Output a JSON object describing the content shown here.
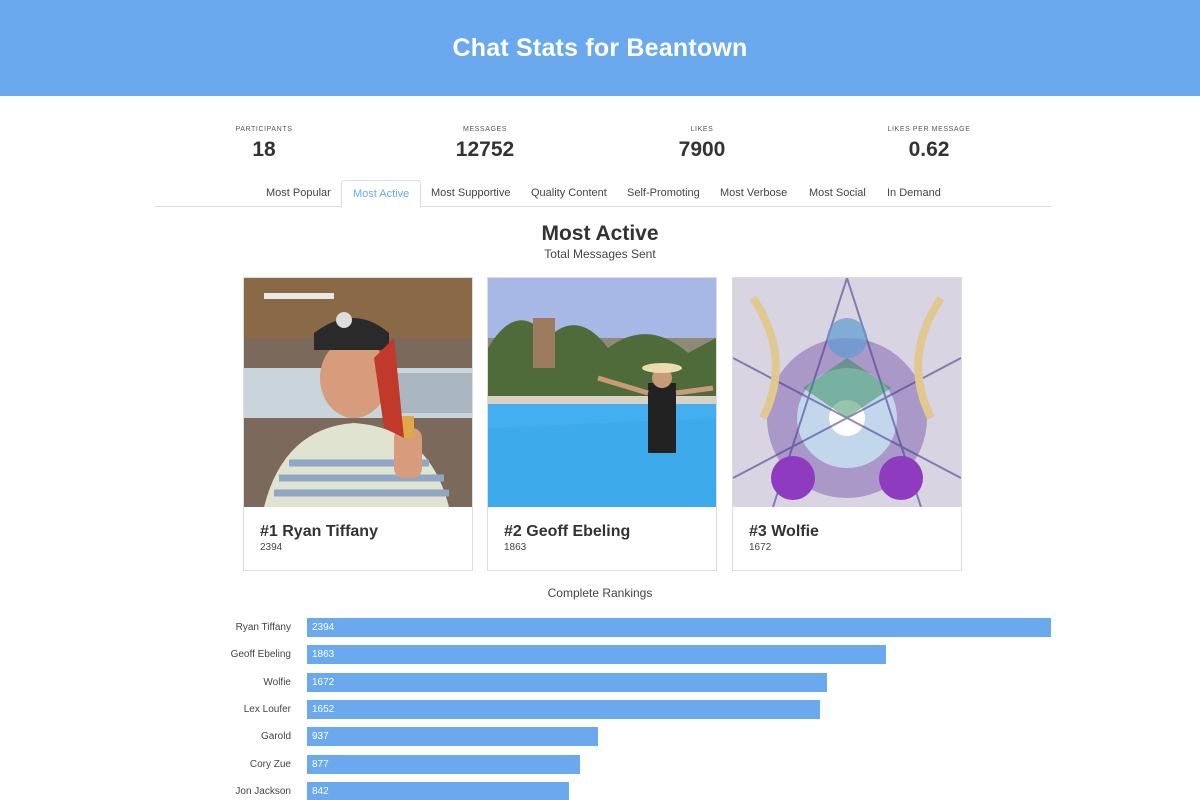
{
  "header": {
    "title": "Chat Stats for Beantown"
  },
  "colors": {
    "accent": "#6aa9ee",
    "border": "#dddddd",
    "text": "#333333"
  },
  "stats": [
    {
      "label": "PARTICIPANTS",
      "value": "18"
    },
    {
      "label": "MESSAGES",
      "value": "12752"
    },
    {
      "label": "LIKES",
      "value": "7900"
    },
    {
      "label": "LIKES PER MESSAGE",
      "value": "0.62"
    }
  ],
  "tabs": [
    {
      "label": "Most Popular",
      "active": false
    },
    {
      "label": "Most Active",
      "active": true
    },
    {
      "label": "Most Supportive",
      "active": false
    },
    {
      "label": "Quality Content",
      "active": false
    },
    {
      "label": "Self-Promoting",
      "active": false
    },
    {
      "label": "Most Verbose",
      "active": false
    },
    {
      "label": "Most Social",
      "active": false
    },
    {
      "label": "In Demand",
      "active": false
    }
  ],
  "section": {
    "title": "Most Active",
    "subtitle": "Total Messages Sent"
  },
  "top3": [
    {
      "name": "#1 Ryan Tiffany",
      "count": "2394"
    },
    {
      "name": "#2 Geoff Ebeling",
      "count": "1863"
    },
    {
      "name": "#3 Wolfie",
      "count": "1672"
    }
  ],
  "rankings": {
    "title": "Complete Rankings",
    "max": 2394,
    "items": [
      {
        "name": "Ryan Tiffany",
        "value": 2394
      },
      {
        "name": "Geoff Ebeling",
        "value": 1863
      },
      {
        "name": "Wolfie",
        "value": 1672
      },
      {
        "name": "Lex Loufer",
        "value": 1652
      },
      {
        "name": "Garold",
        "value": 937
      },
      {
        "name": "Cory Zue",
        "value": 877
      },
      {
        "name": "Jon Jackson",
        "value": 842
      }
    ]
  }
}
